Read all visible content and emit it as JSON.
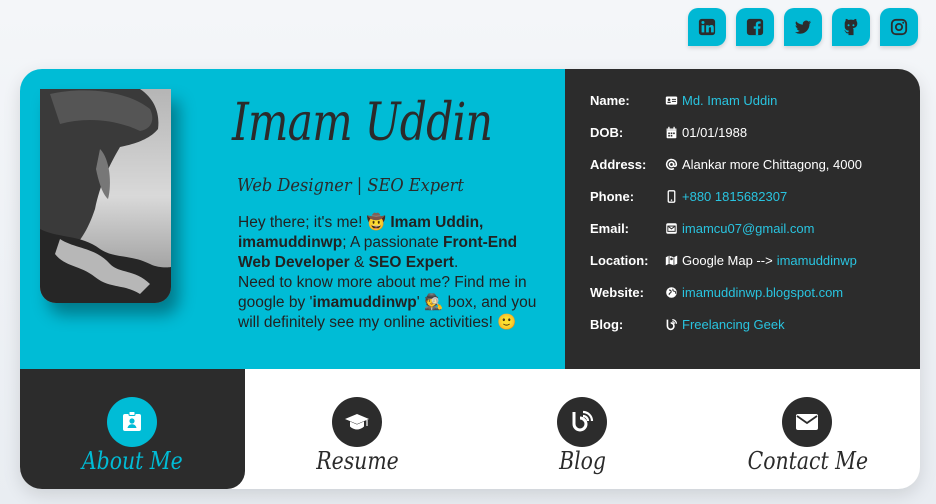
{
  "social": [
    {
      "name": "linkedin-icon"
    },
    {
      "name": "facebook-icon"
    },
    {
      "name": "twitter-icon"
    },
    {
      "name": "github-icon"
    },
    {
      "name": "instagram-icon"
    }
  ],
  "profile": {
    "name": "Imam Uddin",
    "tagline": "Web Designer | SEO Expert",
    "bio": {
      "p1": "Hey there; it's me! ",
      "emoji1": "🤠",
      "p2": " ",
      "bold1": "Imam Uddin,",
      "p3": " ",
      "bold2": "imamuddinwp",
      "p4": "; A passionate ",
      "bold3": "Front-End Web Developer",
      "p5": " & ",
      "bold4": "SEO Expert",
      "p6": ".",
      "p7": "Need to know more about me? Find me in google by '",
      "bold5": "imamuddinwp",
      "p8": "' ",
      "emoji2": "🕵",
      "p9": " box, and you will definitely see my online activities! ",
      "emoji3": "🙂"
    }
  },
  "info": {
    "name": {
      "label": "Name:",
      "value": "Md. Imam Uddin"
    },
    "dob": {
      "label": "DOB:",
      "value": "01/01/1988"
    },
    "address": {
      "label": "Address:",
      "value": "Alankar more Chittagong, 4000"
    },
    "phone": {
      "label": "Phone:",
      "value": "+880 1815682307"
    },
    "email": {
      "label": "Email:",
      "value": "imamcu07@gmail.com"
    },
    "location": {
      "label": "Location:",
      "prefix": "Google Map -->",
      "value": "imamuddinwp"
    },
    "website": {
      "label": "Website:",
      "value": "imamuddinwp.blogspot.com"
    },
    "blog": {
      "label": "Blog:",
      "value": "Freelancing Geek"
    }
  },
  "nav": {
    "about": "About Me",
    "resume": "Resume",
    "blog": "Blog",
    "contact": "Contact Me"
  },
  "colors": {
    "accent": "#00bcd6",
    "dark": "#2c2c2c",
    "link": "#29c4e0"
  }
}
